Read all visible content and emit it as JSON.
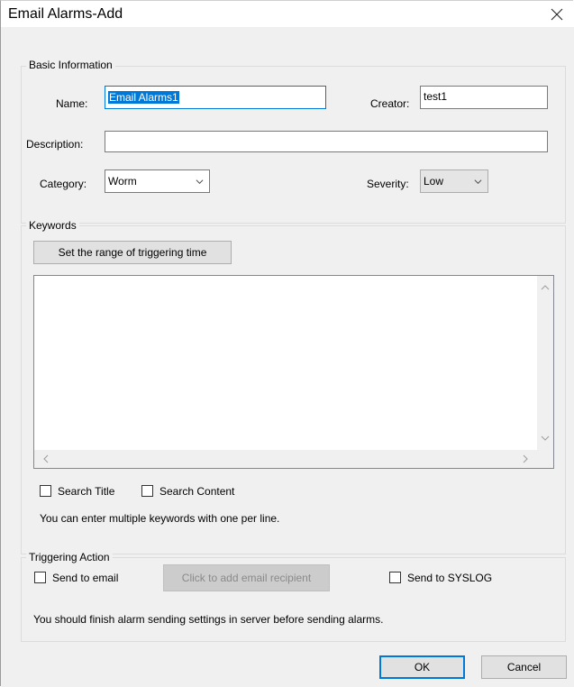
{
  "window": {
    "title": "Email Alarms-Add",
    "close_icon": "close-icon"
  },
  "basic_info": {
    "legend": "Basic Information",
    "name_label": "Name:",
    "name_value": "Email Alarms1",
    "creator_label": "Creator:",
    "creator_value": "test1",
    "description_label": "Description:",
    "description_value": "",
    "category_label": "Category:",
    "category_value": "Worm",
    "severity_label": "Severity:",
    "severity_value": "Low"
  },
  "keywords": {
    "legend": "Keywords",
    "range_button": "Set the range of triggering time",
    "text_value": "",
    "search_title_label": "Search Title",
    "search_title_checked": false,
    "search_content_label": "Search Content",
    "search_content_checked": false,
    "hint": "You can enter multiple keywords with one per line."
  },
  "triggering_action": {
    "legend": "Triggering Action",
    "send_email_label": "Send to email",
    "send_email_checked": false,
    "add_recipient_button": "Click to add email recipient",
    "send_syslog_label": "Send to SYSLOG",
    "send_syslog_checked": false,
    "note": "You should finish alarm sending settings in server before sending alarms."
  },
  "footer": {
    "ok_label": "OK",
    "cancel_label": "Cancel"
  },
  "colors": {
    "accent": "#0078d7",
    "dialog_bg": "#f0f0f0",
    "disabled_bg": "#cccccc"
  }
}
